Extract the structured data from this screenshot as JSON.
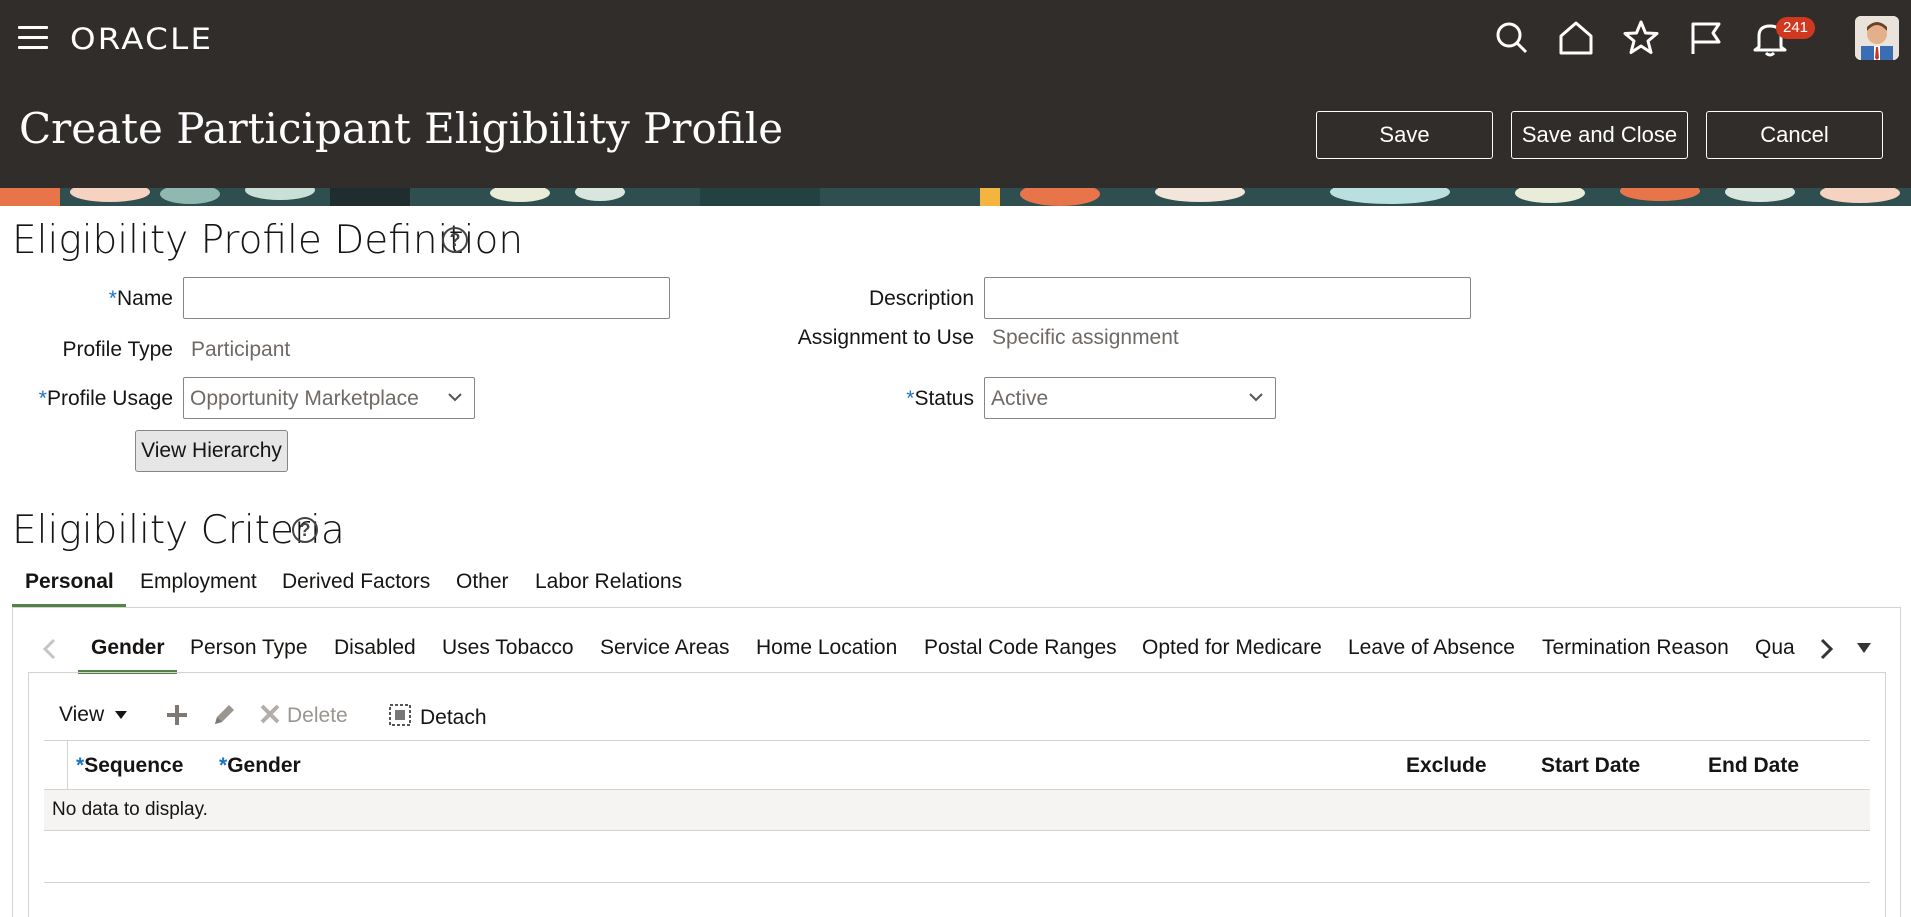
{
  "header": {
    "logo": "ORACLE",
    "notification_count": "241",
    "page_title": "Create Participant Eligibility Profile",
    "buttons": {
      "save": "Save",
      "save_and_close": "Save and Close",
      "cancel": "Cancel"
    }
  },
  "definition": {
    "title": "Eligibility Profile Definition",
    "name_label": "Name",
    "name_value": "",
    "description_label": "Description",
    "description_value": "",
    "profile_type_label": "Profile Type",
    "profile_type_value": "Participant",
    "assignment_label": "Assignment to Use",
    "assignment_value": "Specific assignment",
    "profile_usage_label": "Profile Usage",
    "profile_usage_value": "Opportunity Marketplace",
    "status_label": "Status",
    "status_value": "Active",
    "view_hierarchy": "View Hierarchy"
  },
  "criteria": {
    "title": "Eligibility Criteria",
    "tabs": [
      "Personal",
      "Employment",
      "Derived Factors",
      "Other",
      "Labor Relations"
    ],
    "subtabs": [
      "Gender",
      "Person Type",
      "Disabled",
      "Uses Tobacco",
      "Service Areas",
      "Home Location",
      "Postal Code Ranges",
      "Opted for Medicare",
      "Leave of Absence",
      "Termination Reason",
      "Qua"
    ],
    "toolbar": {
      "view": "View",
      "delete": "Delete",
      "detach": "Detach"
    },
    "columns": {
      "sequence": "Sequence",
      "gender": "Gender",
      "exclude": "Exclude",
      "start_date": "Start Date",
      "end_date": "End Date"
    },
    "empty_text": "No data to display."
  },
  "colors": {
    "header_bg": "#312d2a",
    "accent_green": "#518346",
    "required_blue": "#1a73c9",
    "badge_red": "#d0391f"
  }
}
